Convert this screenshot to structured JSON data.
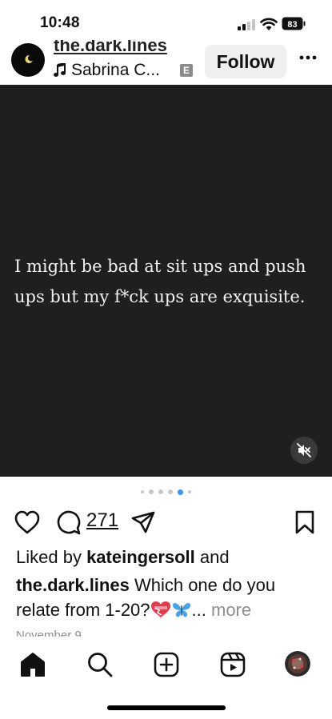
{
  "status_bar": {
    "time": "10:48",
    "battery": "83"
  },
  "post_header": {
    "username": "the.dark.lines",
    "song": "Sabrina C...",
    "explicit_badge": "E",
    "follow_label": "Follow"
  },
  "media": {
    "quote": "I might be bad at sit ups and push ups but my f*ck ups are exquisite.",
    "carousel_total": 6,
    "carousel_active_index": 4
  },
  "actions": {
    "comment_count": "271"
  },
  "caption": {
    "liked_by_prefix": "Liked by ",
    "liked_by_user": "kateingersoll",
    "liked_by_suffix": " and",
    "author": "the.dark.lines",
    "text": " Which one do you relate from 1-20?",
    "ellipsis": "...",
    "more_label": " more",
    "date": "November 9"
  },
  "colors": {
    "accent": "#3897f0",
    "media_bg": "#1f1f1f",
    "muted_text": "#8e8e8e"
  },
  "icons": {
    "status": [
      "signal-icon",
      "wifi-icon",
      "battery-icon"
    ],
    "actions": [
      "heart-icon",
      "comment-icon",
      "share-icon",
      "bookmark-icon"
    ],
    "tabs": [
      "home-icon",
      "search-icon",
      "create-icon",
      "reels-icon",
      "profile-avatar"
    ]
  }
}
